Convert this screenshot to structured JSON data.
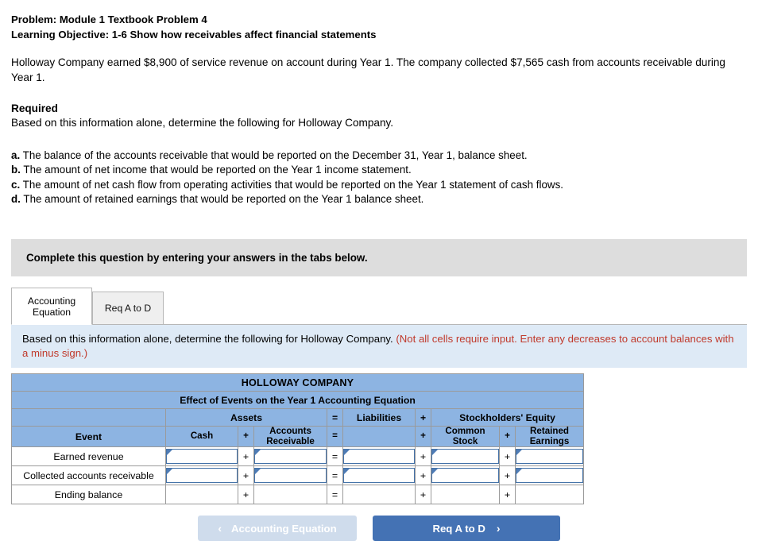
{
  "problem": {
    "line1": "Problem: Module 1 Textbook Problem 4",
    "line2": "Learning Objective: 1-6 Show how receivables affect financial statements",
    "paragraph": "Holloway Company earned $8,900 of service revenue on account during Year 1. The company collected $7,565 cash from accounts receivable during Year 1.",
    "required_title": "Required",
    "required_sub": "Based on this information alone, determine the following for Holloway Company.",
    "items": [
      {
        "letter": "a.",
        "text": "The balance of the accounts receivable that would be reported on the December 31, Year 1, balance sheet."
      },
      {
        "letter": "b.",
        "text": "The amount of net income that would be reported on the Year 1 income statement."
      },
      {
        "letter": "c.",
        "text": "The amount of net cash flow from operating activities that would be reported on the Year 1 statement of cash flows."
      },
      {
        "letter": "d.",
        "text": "The amount of retained earnings that would be reported on the Year 1 balance sheet."
      }
    ]
  },
  "banner": {
    "text": "Complete this question by entering your answers in the tabs below."
  },
  "tabs": [
    {
      "label_line1": "Accounting",
      "label_line2": "Equation",
      "active": true
    },
    {
      "label_line1": "Req A to D",
      "label_line2": "",
      "active": false
    }
  ],
  "infobar": {
    "black_text": "Based on this information alone, determine the following for Holloway Company.",
    "red_text": "(Not all cells require input. Enter any decreases to account balances with a minus sign.)",
    "red_color": "#c0392b",
    "background": "#deeaf6"
  },
  "table": {
    "company_title": "HOLLOWAY COMPANY",
    "subtitle": "Effect of Events on the Year 1 Accounting Equation",
    "group_headers": {
      "assets": "Assets",
      "eq_sign": "=",
      "liabilities": "Liabilities",
      "plus_sign": "+",
      "stockholders_equity": "Stockholders' Equity"
    },
    "column_headers": {
      "event": "Event",
      "cash": "Cash",
      "plus1": "+",
      "accounts_receivable_line1": "Accounts",
      "accounts_receivable_line2": "Receivable",
      "equals": "=",
      "liabilities": "",
      "plus2": "+",
      "common_stock_line1": "Common",
      "common_stock_line2": "Stock",
      "plus3": "+",
      "retained_earnings_line1": "Retained",
      "retained_earnings_line2": "Earnings"
    },
    "rows": [
      {
        "event": "Earned revenue",
        "type": "input",
        "cash": "",
        "accounts_receivable": "",
        "liabilities": "",
        "common_stock": "",
        "retained_earnings": ""
      },
      {
        "event": "Collected accounts receivable",
        "type": "input",
        "cash": "",
        "accounts_receivable": "",
        "liabilities": "",
        "common_stock": "",
        "retained_earnings": ""
      },
      {
        "event": "Ending balance",
        "type": "total",
        "cash": "",
        "accounts_receivable": "",
        "liabilities": "",
        "common_stock": "",
        "retained_earnings": ""
      }
    ],
    "operators": {
      "plus": "+",
      "equals": "="
    },
    "header_color": "#8db4e2"
  },
  "footer": {
    "prev_label": "Accounting Equation",
    "prev_icon": "chevron-left-icon",
    "prev_chevron": "‹",
    "next_label": "Req A to D",
    "next_icon": "chevron-right-icon",
    "next_chevron": "›",
    "prev_color": "#cfdcec",
    "next_color": "#4472b4"
  }
}
